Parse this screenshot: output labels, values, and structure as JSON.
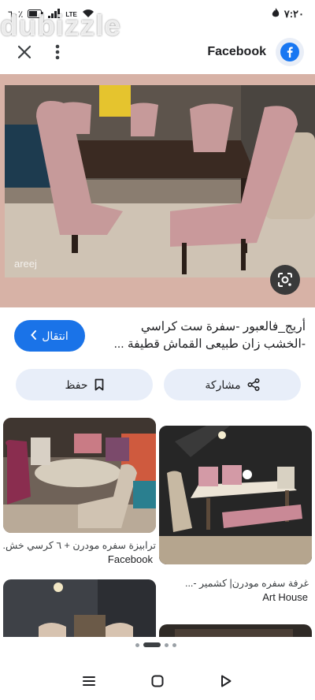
{
  "status_bar": {
    "time": "٧:٢٠",
    "battery": "٦٠٪",
    "network": "LTE"
  },
  "watermark": "dubizzle",
  "top_bar": {
    "source_name": "Facebook"
  },
  "hero": {
    "photo_watermark": "areej"
  },
  "result": {
    "title": "أريج_فالعبور -سفرة ست كراسي -الخشب زان طبيعى القماش قطيفة ...",
    "visit_label": "انتقال"
  },
  "actions": {
    "share_label": "مشاركة",
    "save_label": "حفظ"
  },
  "related": [
    {
      "caption": "ترابيزة سفره مودرن + ٦ كرسي خش...",
      "source": "Facebook"
    },
    {
      "caption": "غرفة سفره مودرن| كشمير -...",
      "source": "Art House"
    }
  ],
  "colors": {
    "hero_background": "#d7b2a6",
    "visit_button": "#1a73e8",
    "action_button": "#e8eef9",
    "facebook_blue": "#1877f2"
  },
  "icons": {
    "close": "close-icon",
    "more": "more-vert-icon",
    "facebook": "facebook-logo-icon",
    "lens": "google-lens-icon",
    "share": "share-icon",
    "bookmark": "bookmark-icon"
  }
}
